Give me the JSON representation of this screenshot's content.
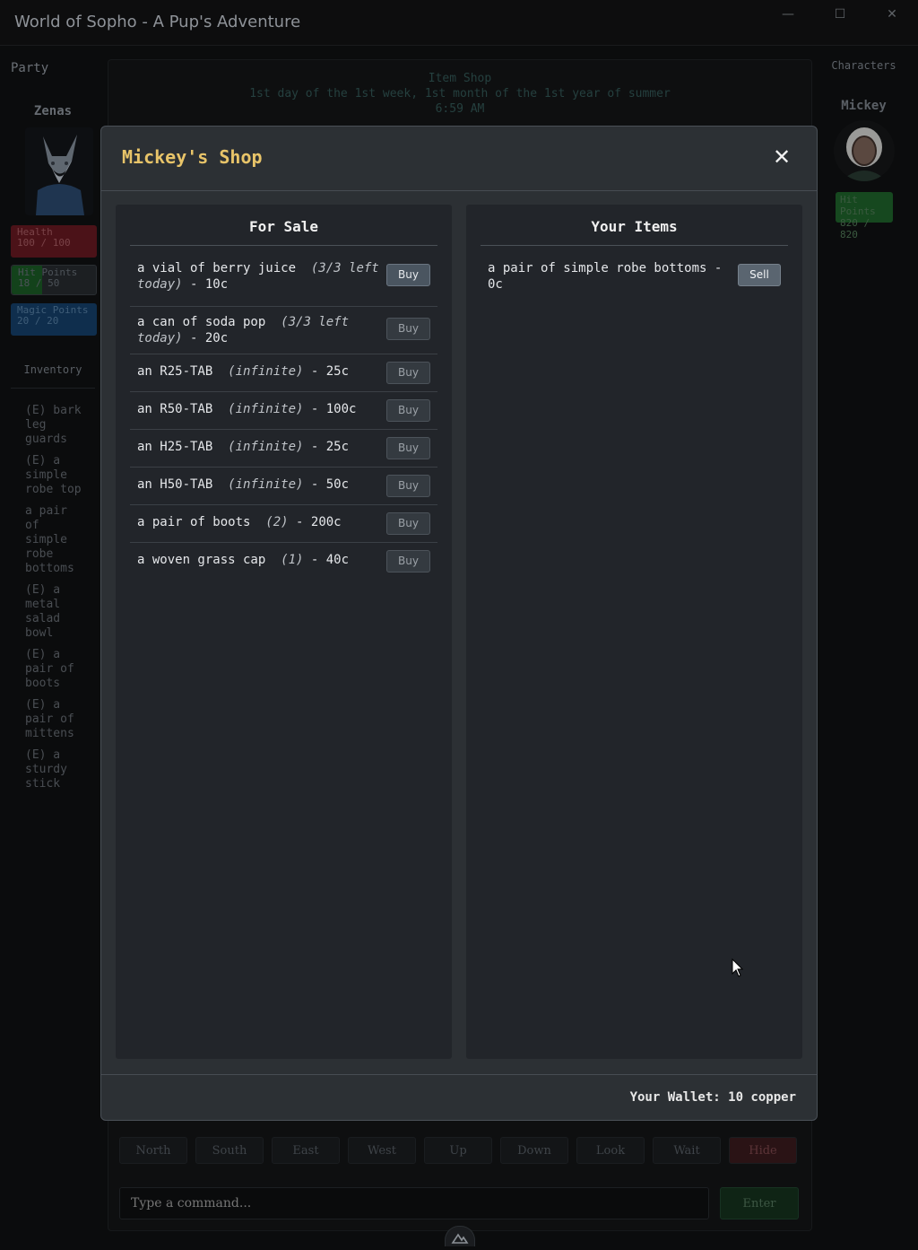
{
  "window": {
    "title": "World of Sopho - A Pup's Adventure",
    "minimize": "—",
    "maximize": "☐",
    "close": "✕"
  },
  "party": {
    "label": "Party",
    "member_name": "Zenas",
    "health_label": "Health",
    "health_value": "100 / 100",
    "hp_label": "Hit Points",
    "hp_value": "18 / 50",
    "hp_fraction": 0.36,
    "mp_label": "Magic Points",
    "mp_value": "20 / 20"
  },
  "inventory": {
    "label": "Inventory",
    "items": [
      "(E) bark leg guards",
      "(E) a simple robe top",
      "a pair of simple robe bottoms",
      "(E) a metal salad bowl",
      "(E) a pair of boots",
      "(E) a pair of mittens",
      "(E) a sturdy stick"
    ]
  },
  "characters": {
    "label": "Characters",
    "name": "Mickey",
    "hp_label": "Hit Points",
    "hp_value": "820 / 820"
  },
  "status": {
    "location": "Item Shop",
    "date": "1st day of the 1st week, 1st month of the 1st year of summer",
    "time": "6:59 AM"
  },
  "directions": [
    "North",
    "South",
    "East",
    "West",
    "Up",
    "Down",
    "Look",
    "Wait",
    "Hide"
  ],
  "command": {
    "placeholder": "Type a command...",
    "enter_label": "Enter"
  },
  "shop": {
    "title": "Mickey's Shop",
    "close_glyph": "✕",
    "for_sale_title": "For Sale",
    "your_items_title": "Your Items",
    "buy_label": "Buy",
    "sell_label": "Sell",
    "for_sale": [
      {
        "name": "a vial of berry juice",
        "note": "(3/3 left today)",
        "price": "- 10c"
      },
      {
        "name": "a can of soda pop",
        "note": "(3/3 left today)",
        "price": "- 20c"
      },
      {
        "name": "an R25-TAB",
        "note": "(infinite)",
        "price": "- 25c"
      },
      {
        "name": "an R50-TAB",
        "note": "(infinite)",
        "price": "- 100c"
      },
      {
        "name": "an H25-TAB",
        "note": "(infinite)",
        "price": "- 25c"
      },
      {
        "name": "an H50-TAB",
        "note": "(infinite)",
        "price": "- 50c"
      },
      {
        "name": "a pair of boots",
        "note": "(2)",
        "price": "- 200c"
      },
      {
        "name": "a woven grass cap",
        "note": "(1)",
        "price": "- 40c"
      }
    ],
    "your_items": [
      {
        "name": "a pair of simple robe bottoms",
        "price": "- 0c"
      }
    ],
    "wallet": "Your Wallet: 10 copper"
  }
}
